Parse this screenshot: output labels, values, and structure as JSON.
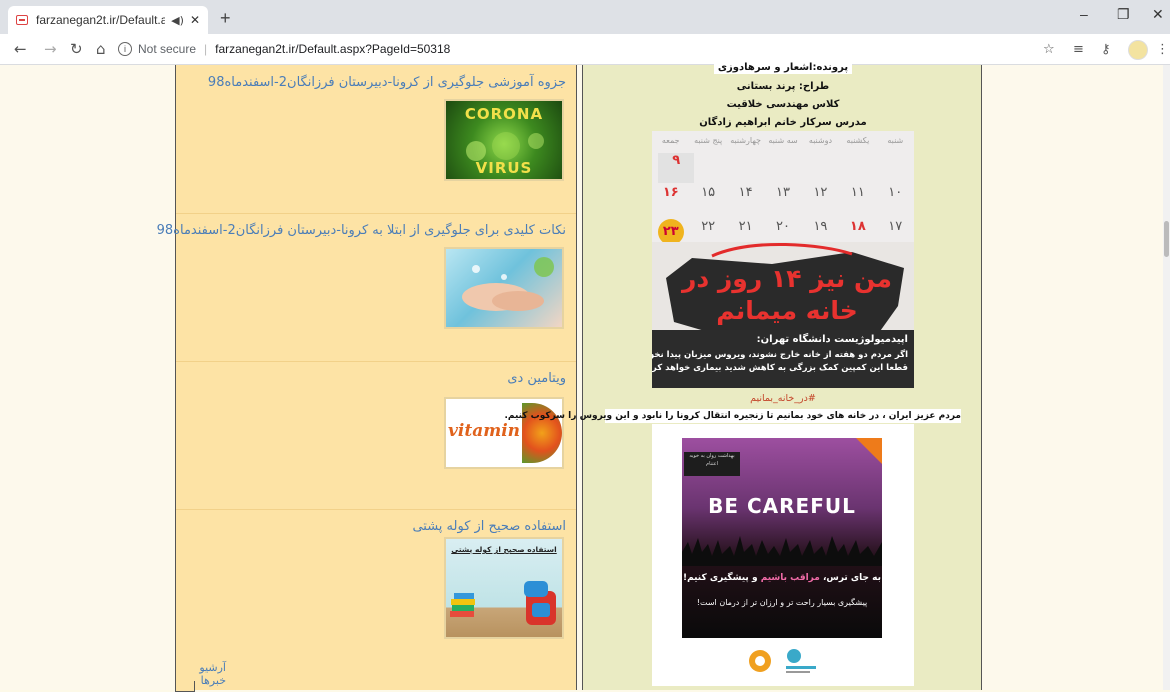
{
  "browser": {
    "tab_title": "farzanegan2t.ir/Default.aspx",
    "new_tab": "+",
    "not_secure": "Not secure",
    "url": "farzanegan2t.ir/Default.aspx?PageId=50318"
  },
  "news": [
    {
      "title": "جزوه آموزشی جلوگیری از کرونا-دبیرستان فرزانگان2-اسفندماه98",
      "thumb_text_top": "CORONA",
      "thumb_text_bottom": "VIRUS"
    },
    {
      "title": "نکات کلیدی برای جلوگیری از ابتلا به کرونا-دبیرستان فرزانگان2-اسفندماه98"
    },
    {
      "title": "ویتامین دی",
      "thumb_text": "vitamin",
      "thumb_letter": "D"
    },
    {
      "title": "استفاده صحیح از کوله پشتی",
      "thumb_text": "استفاده صحیح از کوله پشتی"
    }
  ],
  "archive_label": "آرشیو خبرها",
  "credits": {
    "line0": "پرونده:اشعار و سرهادوزی",
    "line1": "طراح: پرند بستانی",
    "line2": "کلاس مهندسی خلاقیت",
    "line3": "مدرس سرکار خانم ابراهیم زادگان"
  },
  "calendar": {
    "days": [
      "شنبه",
      "یکشنبه",
      "دوشنبه",
      "سه شنبه",
      "چهارشنبه",
      "پنج شنبه",
      "جمعه"
    ],
    "rows": [
      [
        "",
        "",
        "",
        "",
        "",
        "",
        "۹"
      ],
      [
        "۱۰",
        "۱۱",
        "۱۲",
        "۱۳",
        "۱۴",
        "۱۵",
        "۱۶"
      ],
      [
        "۱۷",
        "۱۸",
        "۱۹",
        "۲۰",
        "۲۱",
        "۲۲",
        "۲۳"
      ]
    ]
  },
  "poster1": {
    "headline1": "من نیز ۱۴ روز در",
    "headline2": "خانه میمانم",
    "line1": "اپیدمیولوژیست دانشگاه تهران:",
    "line2": "اگر مردم دو هفته از خانه خارج نشوند، ویروس میزبان پیدا نخواهد کرد",
    "line3": "قطعا این کمپین کمک بزرگی به کاهش شدید بیماری خواهد کرد"
  },
  "hashtag": "#در_خانه_بمانیم",
  "body_text": "مردم عزیز ایران ، در خانه های خود بمانیم تا زنجیره انتقال کرونا را نابود و این ویروس را سرکوب کنیم.",
  "poster2": {
    "badge": "بهداشت روان به خوبه اعتنام",
    "title": "BE CAREFUL",
    "line1_a": "به جای ترس،",
    "line1_b": "مراقب باشیم",
    "line1_c": "و پیشگیری کنیم!",
    "line2": "پیشگیری بسیار راحت تر و ارزان تر از درمان است!"
  }
}
